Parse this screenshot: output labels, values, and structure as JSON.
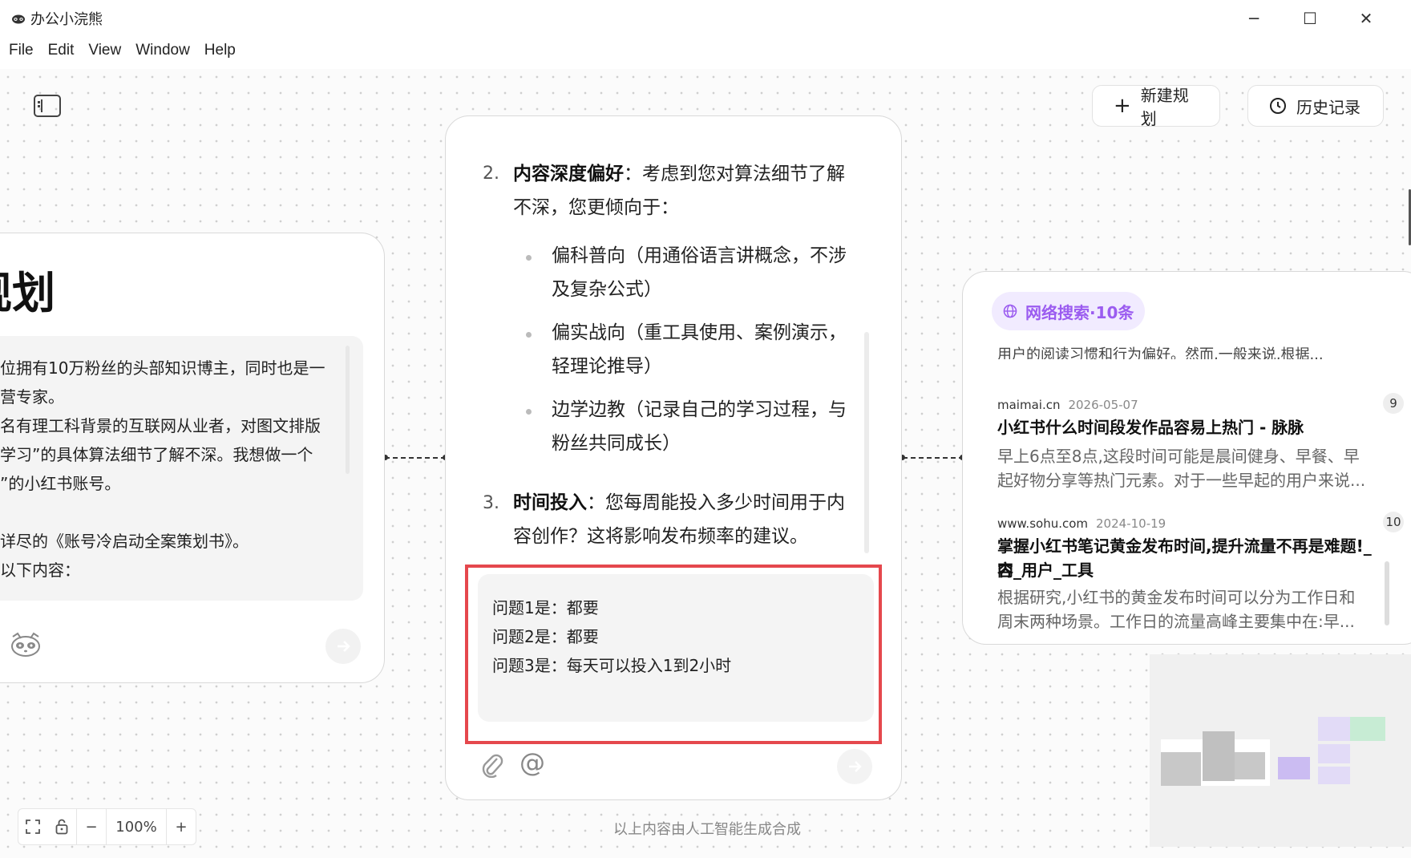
{
  "window": {
    "app_title": "办公小浣熊",
    "minimize_icon": "─",
    "maximize_icon": "☐",
    "close_icon": "✕"
  },
  "menu": [
    "File",
    "Edit",
    "View",
    "Window",
    "Help"
  ],
  "toolbar": {
    "new_plan_label": "新建规划",
    "history_label": "历史记录"
  },
  "left_card": {
    "title_fragment": "规划",
    "lines": [
      "位拥有10万粉丝的头部知识博主，同时也是一",
      "营专家。",
      "名有理工科背景的互联网从业者，对图文排版",
      "学习”的具体算法细节了解不深。我想做一个",
      "”的小红书账号。",
      "",
      "详尽的《账号冷启动全案策划书》。",
      "以下内容："
    ]
  },
  "middle_card": {
    "q2_num": "2.",
    "q2_bold": "内容深度偏好",
    "q2_rest_line1": "：考虑到您对算法细节了解",
    "q2_rest_line2": "不深，您更倾向于：",
    "bullets": [
      {
        "line1": "偏科普向（用通俗语言讲概念，不涉",
        "line2": "及复杂公式）"
      },
      {
        "line1": "偏实战向（重工具使用、案例演示，",
        "line2": "轻理论推导）"
      },
      {
        "line1": "边学边教（记录自己的学习过程，与",
        "line2": "粉丝共同成长）"
      }
    ],
    "q3_num": "3.",
    "q3_bold": "时间投入",
    "q3_rest_line1": "：您每周能投入多少时间用于内",
    "q3_rest_line2": "容创作？这将影响发布频率的建议。",
    "answers": [
      "问题1是：都要",
      "问题2是：都要",
      "问题3是：每天可以投入1到2小时"
    ]
  },
  "disclaimer": "以上内容由人工智能生成合成",
  "right_card": {
    "tag": "网络搜索·10条",
    "cut_line": "用户的阅读习惯和行为偏好。然而,一般来说,根据...",
    "results": [
      {
        "source": "maimai.cn",
        "date": "2026-05-07",
        "badge": "9",
        "title_line1": "小红书什么时间段发作品容易上热门 - 脉脉",
        "title_line2": "",
        "snippet_line1": "早上6点至8点,这段时间可能是晨间健身、早餐、早",
        "snippet_line2": "起好物分享等热门元素。对于一些早起的用户来说..."
      },
      {
        "source": "www.sohu.com",
        "date": "2024-10-19",
        "badge": "10",
        "title_line1": "掌握小红书笔记黄金发布时间,提升流量不再是难题!_内",
        "title_line2": "容_用户_工具",
        "snippet_line1": "根据研究,小红书的黄金发布时间可以分为工作日和",
        "snippet_line2": "周末两种场景。工作日的流量高峰主要集中在:早..."
      }
    ]
  },
  "zoom": {
    "minus": "−",
    "level": "100%",
    "plus": "+"
  },
  "colors": {
    "highlight_border": "#e5484d",
    "tag_purple": "#9b5cf0",
    "tag_bg": "#f1ebff"
  }
}
